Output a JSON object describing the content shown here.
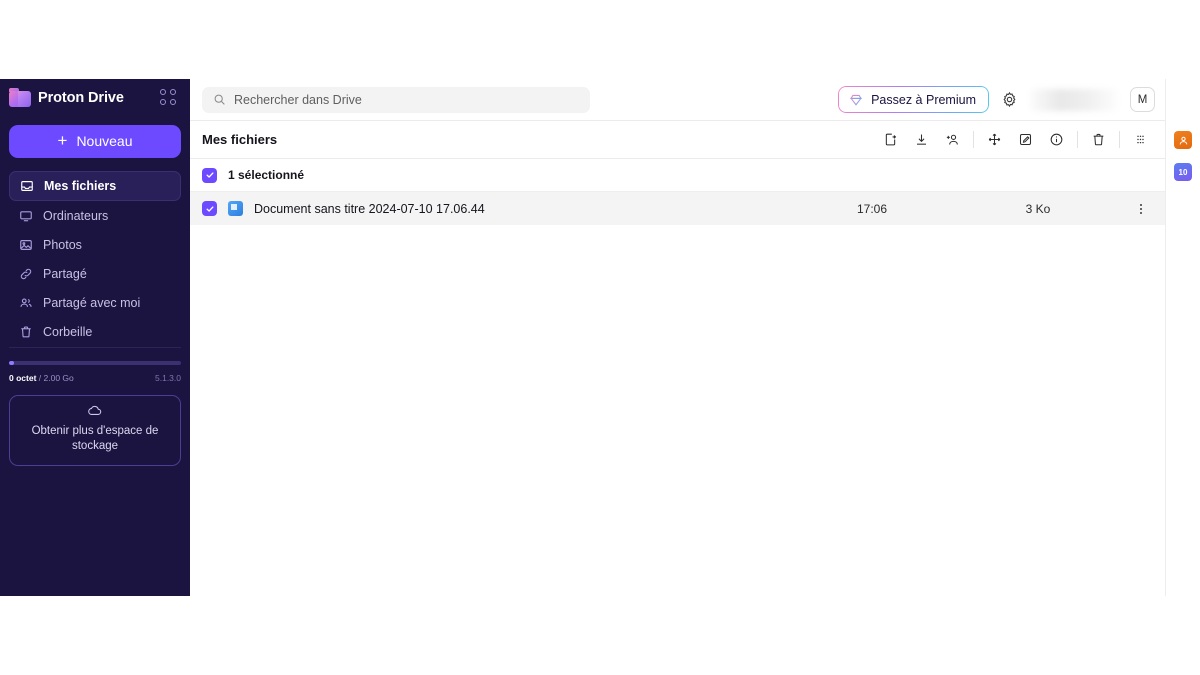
{
  "sidebar": {
    "brand": "Proton Drive",
    "apps_grid_icon": "apps-grid-icon",
    "new_button": {
      "label": "Nouveau",
      "plus": "+"
    },
    "items": [
      {
        "label": "Mes fichiers",
        "icon": "tray-icon",
        "active": true
      },
      {
        "label": "Ordinateurs",
        "icon": "monitor-icon",
        "active": false
      },
      {
        "label": "Photos",
        "icon": "image-icon",
        "active": false
      },
      {
        "label": "Partagé",
        "icon": "link-icon",
        "active": false
      },
      {
        "label": "Partagé avec moi",
        "icon": "users-icon",
        "active": false
      },
      {
        "label": "Corbeille",
        "icon": "trash-icon",
        "active": false
      }
    ],
    "storage": {
      "used": "0 octet",
      "separator": " / ",
      "total": "2.00 Go",
      "version": "5.1.3.0",
      "percent": 0
    },
    "upsell": {
      "icon": "cloud-icon",
      "line1": "Obtenir plus d'espace de",
      "line2": "stockage"
    }
  },
  "topbar": {
    "search": {
      "placeholder": "Rechercher dans Drive",
      "icon": "search-icon"
    },
    "premium": {
      "label": "Passez à Premium",
      "icon": "gem-icon"
    },
    "settings_icon": "gear-icon",
    "avatar": "M"
  },
  "toolbar": {
    "breadcrumb": "Mes fichiers",
    "actions": [
      {
        "name": "share-file-icon",
        "title": "Partager le fichier"
      },
      {
        "name": "download-icon",
        "title": "Télécharger"
      },
      {
        "name": "share-with-user-icon",
        "title": "Partager avec"
      },
      {
        "name": "move-icon",
        "title": "Déplacer"
      },
      {
        "name": "rename-icon",
        "title": "Renommer"
      },
      {
        "name": "details-icon",
        "title": "Détails"
      },
      {
        "name": "trash-icon",
        "title": "Déplacer vers la corbeille"
      },
      {
        "name": "layout-icon",
        "title": "Disposition"
      }
    ]
  },
  "selection": {
    "label": "1 sélectionné"
  },
  "file": {
    "name": "Document sans titre 2024-07-10 17.06.44",
    "time": "17:06",
    "size": "3 Ko",
    "icon": "proton-doc-icon",
    "more_icon": "more-vertical-icon"
  },
  "rail": {
    "extensions": [
      {
        "name": "extension-orange-icon",
        "badge": ""
      },
      {
        "name": "extension-blue-icon",
        "badge": "10"
      }
    ]
  },
  "colors": {
    "sidebar_bg": "#1b1340",
    "accent": "#6d4aff",
    "row_selected_bg": "#f4f4f4",
    "search_bg": "#f3f3f3"
  }
}
